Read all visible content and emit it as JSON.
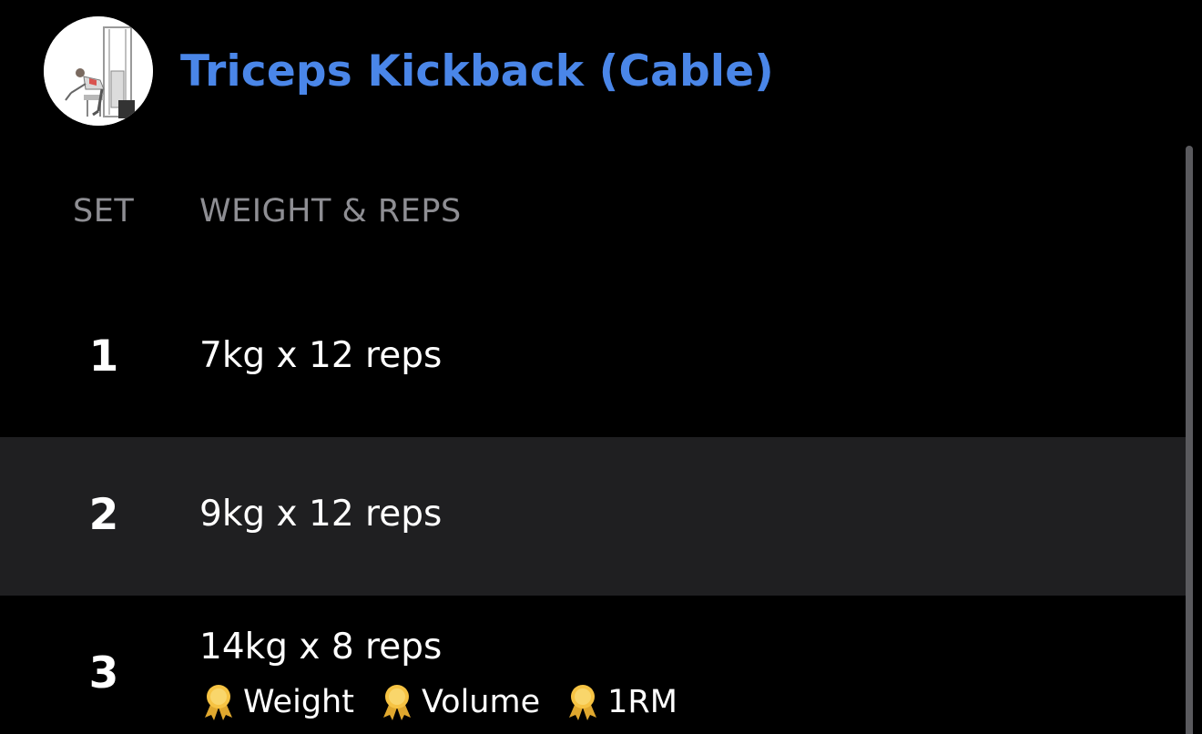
{
  "exercise": {
    "title": "Triceps Kickback (Cable)",
    "image_icon": "exercise-illustration-icon",
    "title_color": "#4a86e8"
  },
  "columns": {
    "set": "SET",
    "weight_reps": "WEIGHT & REPS"
  },
  "sets": [
    {
      "number": "1",
      "value": "7kg x 12 reps"
    },
    {
      "number": "2",
      "value": "9kg x 12 reps"
    },
    {
      "number": "3",
      "value": "14kg x 8 reps",
      "records": [
        {
          "icon": "medal-icon",
          "label": "Weight"
        },
        {
          "icon": "medal-icon",
          "label": "Volume"
        },
        {
          "icon": "medal-icon",
          "label": "1RM"
        }
      ]
    }
  ],
  "colors": {
    "background": "#000000",
    "highlight_row": "#1f1f21",
    "header_text": "#8e8e93",
    "medal": "#f6c343"
  }
}
